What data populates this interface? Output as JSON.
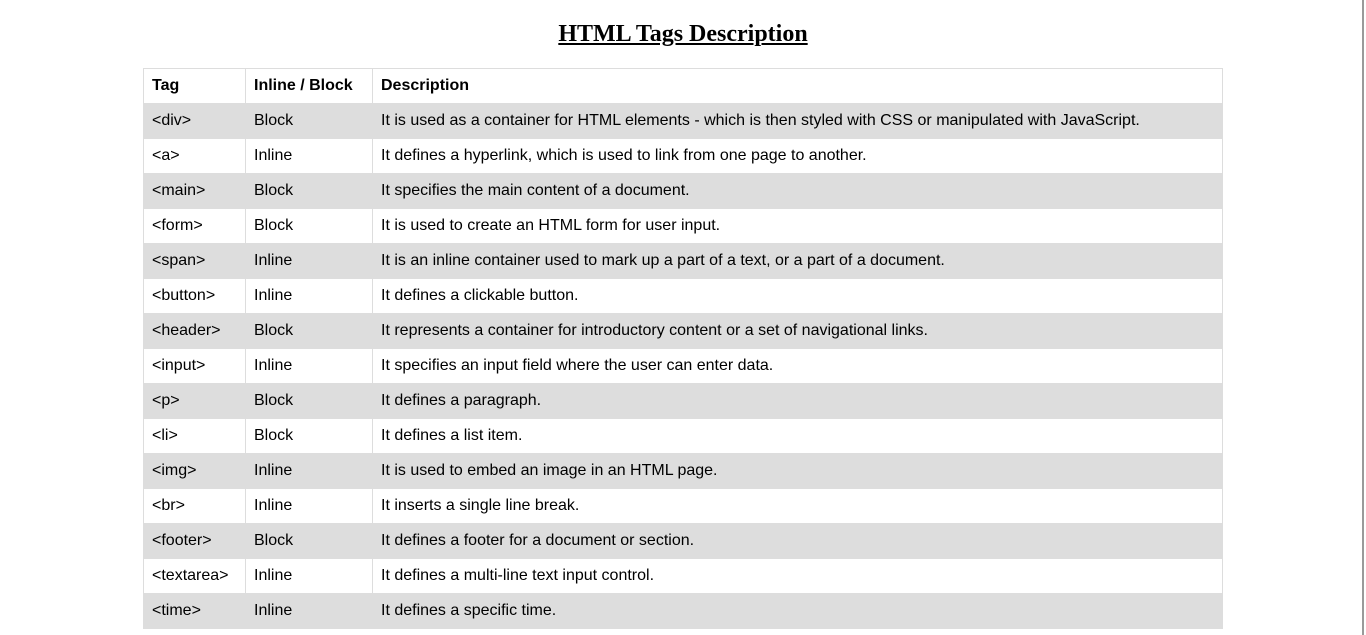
{
  "page": {
    "title": "HTML Tags Description"
  },
  "table": {
    "headers": {
      "tag": "Tag",
      "type": "Inline / Block",
      "description": "Description"
    },
    "rows": [
      {
        "tag": "<div>",
        "type": "Block",
        "description": "It is used as a container for HTML elements - which is then styled with CSS or manipulated with JavaScript."
      },
      {
        "tag": "<a>",
        "type": "Inline",
        "description": "It defines a hyperlink, which is used to link from one page to another."
      },
      {
        "tag": "<main>",
        "type": "Block",
        "description": "It specifies the main content of a document."
      },
      {
        "tag": "<form>",
        "type": "Block",
        "description": "It is used to create an HTML form for user input."
      },
      {
        "tag": "<span>",
        "type": "Inline",
        "description": "It is an inline container used to mark up a part of a text, or a part of a document."
      },
      {
        "tag": "<button>",
        "type": "Inline",
        "description": "It defines a clickable button."
      },
      {
        "tag": "<header>",
        "type": "Block",
        "description": "It represents a container for introductory content or a set of navigational links."
      },
      {
        "tag": "<input>",
        "type": "Inline",
        "description": "It specifies an input field where the user can enter data."
      },
      {
        "tag": "<p>",
        "type": "Block",
        "description": "It defines a paragraph."
      },
      {
        "tag": "<li>",
        "type": "Block",
        "description": "It defines a list item."
      },
      {
        "tag": "<img>",
        "type": "Inline",
        "description": "It is used to embed an image in an HTML page."
      },
      {
        "tag": "<br>",
        "type": "Inline",
        "description": "It inserts a single line break."
      },
      {
        "tag": "<footer>",
        "type": "Block",
        "description": "It defines a footer for a document or section."
      },
      {
        "tag": "<textarea>",
        "type": "Inline",
        "description": "It defines a multi-line text input control."
      },
      {
        "tag": "<time>",
        "type": "Inline",
        "description": "It defines a specific time."
      }
    ]
  },
  "colors": {
    "stripe": "#dddddd",
    "border": "#dddddd",
    "background": "#ffffff"
  }
}
